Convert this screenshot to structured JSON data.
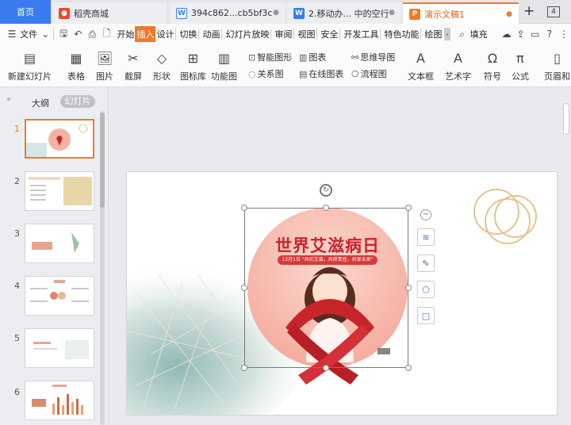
{
  "tabs": {
    "home": "首页",
    "store": "稻壳商城",
    "doc1": "394c862...cb5bf3c",
    "doc2": "2.移动办... 中的空行",
    "ppt": "演示文稿1",
    "count": "4"
  },
  "menu": {
    "file": "文件",
    "items": [
      "开始",
      "插入",
      "设计",
      "切换",
      "动画",
      "幻灯片放映",
      "审阅",
      "视图",
      "安全",
      "开发工具",
      "特色功能",
      "绘图"
    ],
    "active_index": 1,
    "search": "填充"
  },
  "ribbon": {
    "new_slide": "新建幻灯片",
    "table": "表格",
    "picture": "图片",
    "screenshot": "截屏",
    "shape": "形状",
    "icon_lib": "图标库",
    "func_chart": "功能图",
    "smartart": "智能图形",
    "chart": "图表",
    "mindmap": "思维导图",
    "relation": "关系图",
    "online_chart": "在线图表",
    "flowchart": "流程图",
    "textbox": "文本框",
    "wordart": "艺术字",
    "symbol": "符号",
    "formula": "公式",
    "header": "页眉和"
  },
  "panel": {
    "outline": "大纲",
    "slides": "幻灯片",
    "numbers": [
      "1",
      "2",
      "3",
      "4",
      "5",
      "6"
    ]
  },
  "slide": {
    "title": "世界艾滋病日",
    "subtitle": "12月1日 \"共抗艾滋，共担责任，共享未来\""
  },
  "colors": {
    "accent": "#f07a2a",
    "home_tab": "#3a7bf0",
    "ribbon_red": "#c8242c"
  }
}
